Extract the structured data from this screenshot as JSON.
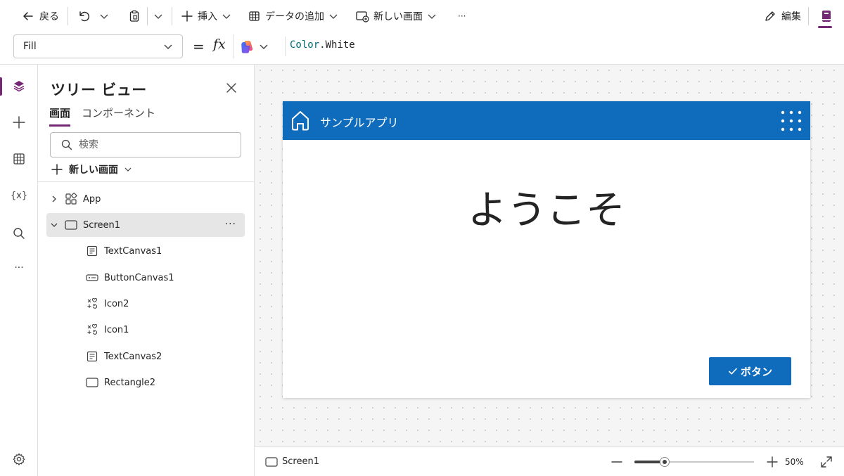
{
  "toolbar": {
    "back_label": "戻る",
    "insert_label": "挿入",
    "add_data_label": "データの追加",
    "new_screen_label": "新しい画面",
    "more_label": "···",
    "edit_label": "編集"
  },
  "formula": {
    "property": "Fill",
    "equals": "=",
    "fx": "fx",
    "value_prefix": "Color",
    "value_suffix": ".White"
  },
  "tree_view": {
    "title": "ツリー ビュー",
    "tabs": [
      "画面",
      "コンポーネント"
    ],
    "search_placeholder": "検索",
    "new_screen_label": "新しい画面",
    "items": [
      {
        "label": "App",
        "icon": "app-icon"
      },
      {
        "label": "Screen1",
        "icon": "screen-icon",
        "selected": true
      },
      {
        "label": "TextCanvas1",
        "icon": "text-icon"
      },
      {
        "label": "ButtonCanvas1",
        "icon": "button-icon"
      },
      {
        "label": "Icon2",
        "icon": "icons-icon"
      },
      {
        "label": "Icon1",
        "icon": "icons-icon"
      },
      {
        "label": "TextCanvas2",
        "icon": "text-icon"
      },
      {
        "label": "Rectangle2",
        "icon": "rectangle-icon"
      }
    ],
    "row_more_label": "···"
  },
  "rail": {
    "variables_label": "{x}",
    "more_label": "···"
  },
  "app_preview": {
    "header_title": "サンプルアプリ",
    "header_color": "#0f6cbd",
    "welcome_text": "ようこそ",
    "button_label": "ボタン"
  },
  "status": {
    "screen_label": "Screen1",
    "zoom_label": "50%",
    "zoom_fraction": 0.25
  },
  "colors": {
    "accent": "#742774",
    "brand_blue": "#0f6cbd"
  }
}
